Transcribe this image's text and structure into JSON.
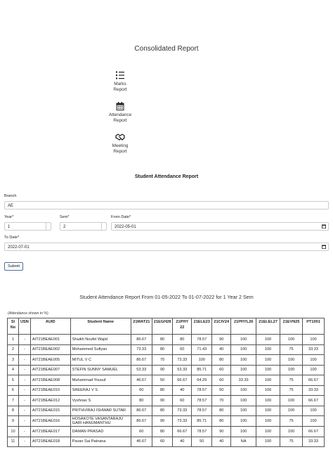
{
  "page_title": "Consolidated Report",
  "nav": [
    {
      "line1": "Marks",
      "line2": "Report",
      "icon": "list-icon"
    },
    {
      "line1": "Attendance",
      "line2": "Report",
      "icon": "calendar-icon"
    },
    {
      "line1": "Meeting",
      "line2": "Report",
      "icon": "handshake-icon"
    }
  ],
  "form": {
    "title": "Student Attendance Report",
    "branch_label": "Branch",
    "branch_value": "AE",
    "year_label": "Year*",
    "year_value": "1",
    "sem_label": "Sem*",
    "sem_value": "2",
    "from_label": "From Date*",
    "from_value": "2022-05-01",
    "to_label": "To Date*",
    "to_value": "2022-07-01",
    "submit_label": "Submit"
  },
  "report": {
    "title": "Student Attendance Report  From 01-05-2022 To 01-07-2022 for  1 Year  2 Sem",
    "note": "(Attendance shown in %)",
    "columns": [
      "Sl No",
      "USN",
      "AUID",
      "Student Name",
      "21MAT21",
      "21EGH28",
      "21PHY 22",
      "21ELE23",
      "21CIV24",
      "21PHYL26",
      "21ELEL27",
      "21EVN25",
      "PT1001"
    ],
    "rows": [
      [
        "1",
        "-",
        "AIT21BEAE001",
        "Shaikh Noufel Wajid",
        "86.67",
        "80",
        "80",
        "78.57",
        "90",
        "100",
        "100",
        "100",
        "100"
      ],
      [
        "2",
        "-",
        "AIT21BEAE002",
        "Mohammed Sufiyan",
        "73.33",
        "80",
        "60",
        "71.43",
        "40",
        "100",
        "100",
        "75",
        "33.33"
      ],
      [
        "3",
        "-",
        "AIT21BEAE005",
        "MITUL V C",
        "86.67",
        "70",
        "73.33",
        "100",
        "80",
        "100",
        "100",
        "100",
        "100"
      ],
      [
        "4",
        "-",
        "AIT21BEAE007",
        "STEFIN SUNNY SAMUEL",
        "53.33",
        "90",
        "53.33",
        "85.71",
        "60",
        "100",
        "100",
        "100",
        "100"
      ],
      [
        "5",
        "-",
        "AIT21BEAE008",
        "Muhammad Yousuf",
        "46.67",
        "50",
        "66.67",
        "64.29",
        "60",
        "33.33",
        "100",
        "75",
        "66.67"
      ],
      [
        "6",
        "-",
        "AIT21BEAE010",
        "SREERAJ V S",
        "60",
        "80",
        "40",
        "78.57",
        "50",
        "100",
        "100",
        "75",
        "33.33"
      ],
      [
        "7",
        "-",
        "AIT21BEAE012",
        "Vyshnav S",
        "80",
        "90",
        "60",
        "78.57",
        "70",
        "100",
        "100",
        "100",
        "66.67"
      ],
      [
        "8",
        "-",
        "AIT21BEAE015",
        "PRITHVIRAJ ISHWAR SUTAR",
        "86.67",
        "80",
        "73.33",
        "78.57",
        "80",
        "100",
        "100",
        "100",
        "100"
      ],
      [
        "9",
        "-",
        "AIT21BEAE016",
        "HOSAKOTE VASANTARAJU GARI HANUMANTHU",
        "86.67",
        "90",
        "73.33",
        "85.71",
        "80",
        "100",
        "100",
        "75",
        "100"
      ],
      [
        "10",
        "-",
        "AIT21BEAE017",
        "DAMAN PRASAD",
        "60",
        "80",
        "66.67",
        "78.57",
        "90",
        "100",
        "100",
        "100",
        "66.67"
      ],
      [
        "11",
        "-",
        "AIT21BEAE018",
        "Pavan Sai Patnana",
        "46.67",
        "60",
        "40",
        "50",
        "40",
        "NA",
        "100",
        "75",
        "33.33"
      ]
    ]
  }
}
